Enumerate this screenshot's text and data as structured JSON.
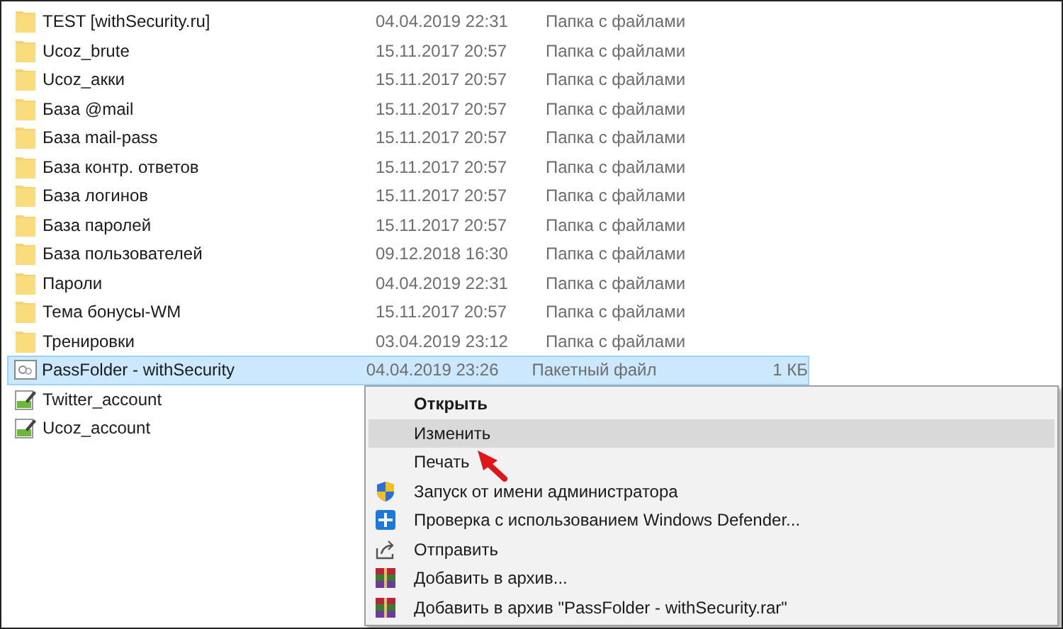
{
  "files": [
    {
      "name": "TEST [withSecurity.ru]",
      "date": "04.04.2019 22:31",
      "type": "Папка с файлами",
      "kind": "folder",
      "selected": false
    },
    {
      "name": "Ucoz_brute",
      "date": "15.11.2017 20:57",
      "type": "Папка с файлами",
      "kind": "folder",
      "selected": false
    },
    {
      "name": "Ucoz_акки",
      "date": "15.11.2017 20:57",
      "type": "Папка с файлами",
      "kind": "folder",
      "selected": false
    },
    {
      "name": "База @mail",
      "date": "15.11.2017 20:57",
      "type": "Папка с файлами",
      "kind": "folder",
      "selected": false
    },
    {
      "name": "База mail-pass",
      "date": "15.11.2017 20:57",
      "type": "Папка с файлами",
      "kind": "folder",
      "selected": false
    },
    {
      "name": "База контр. ответов",
      "date": "15.11.2017 20:57",
      "type": "Папка с файлами",
      "kind": "folder",
      "selected": false
    },
    {
      "name": "База логинов",
      "date": "15.11.2017 20:57",
      "type": "Папка с файлами",
      "kind": "folder",
      "selected": false
    },
    {
      "name": "База паролей",
      "date": "15.11.2017 20:57",
      "type": "Папка с файлами",
      "kind": "folder",
      "selected": false
    },
    {
      "name": "База пользователей",
      "date": "09.12.2018 16:30",
      "type": "Папка с файлами",
      "kind": "folder",
      "selected": false
    },
    {
      "name": "Пароли",
      "date": "04.04.2019 22:31",
      "type": "Папка с файлами",
      "kind": "folder",
      "selected": false
    },
    {
      "name": "Тема бонусы-WM",
      "date": "15.11.2017 20:57",
      "type": "Папка с файлами",
      "kind": "folder",
      "selected": false
    },
    {
      "name": "Тренировки",
      "date": "03.04.2019 23:12",
      "type": "Папка с файлами",
      "kind": "folder",
      "selected": false
    },
    {
      "name": "PassFolder - withSecurity",
      "date": "04.04.2019 23:26",
      "type": "Пакетный файл",
      "size": "1 КБ",
      "kind": "batch",
      "selected": true
    },
    {
      "name": "Twitter_account",
      "kind": "text",
      "selected": false
    },
    {
      "name": "Ucoz_account",
      "kind": "text",
      "selected": false
    }
  ],
  "context_menu": [
    {
      "label": "Открыть",
      "default": true,
      "selected": false
    },
    {
      "label": "Изменить",
      "default": false,
      "selected": true
    },
    {
      "label": "Печать",
      "default": false,
      "selected": false
    },
    {
      "label": "Запуск от имени администратора",
      "kind": "shield",
      "default": false,
      "selected": false
    },
    {
      "label": "Проверка с использованием Windows Defender...",
      "kind": "defender",
      "default": false,
      "selected": false
    },
    {
      "label": "Отправить",
      "kind": "share",
      "default": false,
      "selected": false
    },
    {
      "label": "Добавить в архив...",
      "kind": "archive",
      "default": false,
      "selected": false
    },
    {
      "label": "Добавить в архив \"PassFolder - withSecurity.rar\"",
      "kind": "archive",
      "default": false,
      "selected": false
    }
  ]
}
